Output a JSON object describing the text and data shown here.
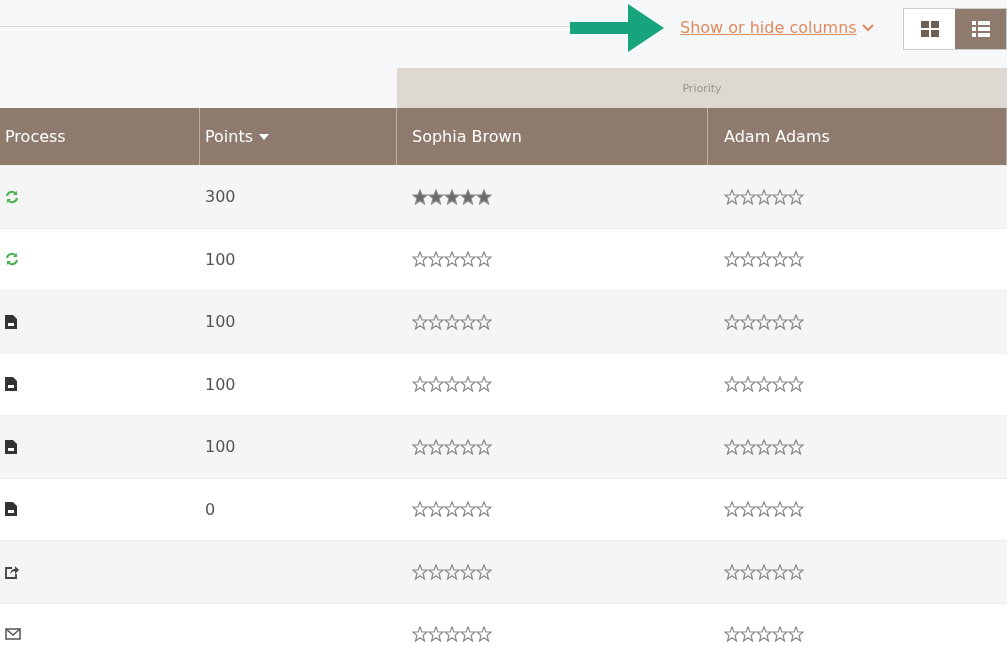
{
  "toolbar": {
    "columns_link": "Show or hide columns",
    "views": [
      {
        "kind": "grid",
        "selected": false
      },
      {
        "kind": "list",
        "selected": true
      }
    ]
  },
  "table": {
    "group_header": "Priority",
    "columns": [
      {
        "label": "Process",
        "sorted": false
      },
      {
        "label": "Points",
        "sorted": true
      },
      {
        "label": "Sophia Brown",
        "sorted": false
      },
      {
        "label": "Adam Adams",
        "sorted": false
      }
    ],
    "rows": [
      {
        "kind": "sync",
        "points": "300",
        "ratings": [
          {
            "stars": 5
          },
          {
            "stars": 0
          }
        ]
      },
      {
        "kind": "sync",
        "points": "100",
        "ratings": [
          {
            "stars": 0
          },
          {
            "stars": 0
          }
        ]
      },
      {
        "kind": "file",
        "points": "100",
        "ratings": [
          {
            "stars": 0
          },
          {
            "stars": 0
          }
        ]
      },
      {
        "kind": "file",
        "points": "100",
        "ratings": [
          {
            "stars": 0
          },
          {
            "stars": 0
          }
        ]
      },
      {
        "kind": "file",
        "points": "100",
        "ratings": [
          {
            "stars": 0
          },
          {
            "stars": 0
          }
        ]
      },
      {
        "kind": "file",
        "points": "0",
        "ratings": [
          {
            "stars": 0
          },
          {
            "stars": 0
          }
        ]
      },
      {
        "kind": "share",
        "ratings": [
          {
            "stars": 0
          },
          {
            "stars": 0
          }
        ]
      },
      {
        "kind": "mail",
        "ratings": [
          {
            "stars": 0
          },
          {
            "stars": 0
          }
        ]
      }
    ]
  }
}
